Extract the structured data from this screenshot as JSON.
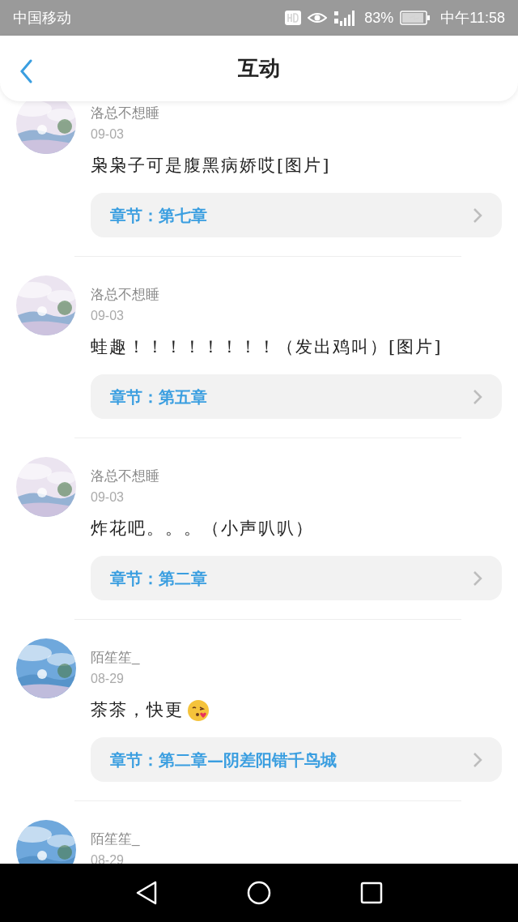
{
  "status_bar": {
    "carrier": "中国移动",
    "battery": "83%",
    "time": "中午11:58"
  },
  "header": {
    "title": "互动"
  },
  "comments": [
    {
      "user": "洛总不想睡",
      "date": "09-03",
      "text": "枭枭子可是腹黑病娇哎[图片]",
      "emoji": false,
      "chapter": "章节：第七章"
    },
    {
      "user": "洛总不想睡",
      "date": "09-03",
      "text": "蛙趣！！！！！！！！（发出鸡叫）[图片]",
      "emoji": false,
      "chapter": "章节：第五章"
    },
    {
      "user": "洛总不想睡",
      "date": "09-03",
      "text": "炸花吧。。。（小声叭叭）",
      "emoji": false,
      "chapter": "章节：第二章"
    },
    {
      "user": "陌笙笙_",
      "date": "08-29",
      "text": "茶茶，快更",
      "emoji": true,
      "chapter": "章节：第二章—阴差阳错千鸟城"
    },
    {
      "user": "陌笙笙_",
      "date": "08-29",
      "emoji": false
    }
  ]
}
